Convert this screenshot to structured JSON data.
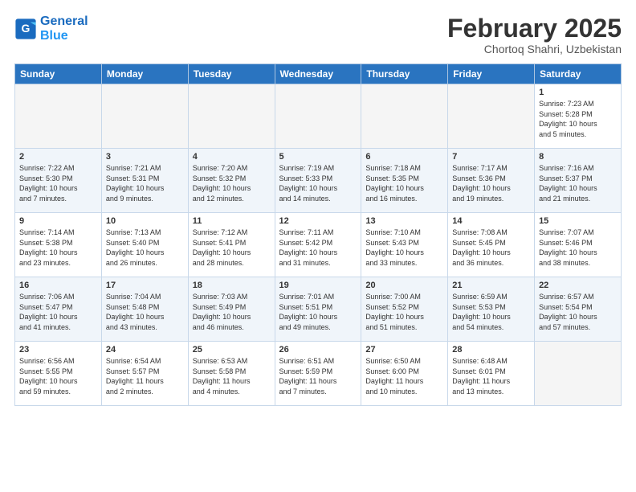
{
  "header": {
    "logo_line1": "General",
    "logo_line2": "Blue",
    "month": "February 2025",
    "location": "Chortoq Shahri, Uzbekistan"
  },
  "days_of_week": [
    "Sunday",
    "Monday",
    "Tuesday",
    "Wednesday",
    "Thursday",
    "Friday",
    "Saturday"
  ],
  "weeks": [
    [
      {
        "num": "",
        "info": ""
      },
      {
        "num": "",
        "info": ""
      },
      {
        "num": "",
        "info": ""
      },
      {
        "num": "",
        "info": ""
      },
      {
        "num": "",
        "info": ""
      },
      {
        "num": "",
        "info": ""
      },
      {
        "num": "1",
        "info": "Sunrise: 7:23 AM\nSunset: 5:28 PM\nDaylight: 10 hours\nand 5 minutes."
      }
    ],
    [
      {
        "num": "2",
        "info": "Sunrise: 7:22 AM\nSunset: 5:30 PM\nDaylight: 10 hours\nand 7 minutes."
      },
      {
        "num": "3",
        "info": "Sunrise: 7:21 AM\nSunset: 5:31 PM\nDaylight: 10 hours\nand 9 minutes."
      },
      {
        "num": "4",
        "info": "Sunrise: 7:20 AM\nSunset: 5:32 PM\nDaylight: 10 hours\nand 12 minutes."
      },
      {
        "num": "5",
        "info": "Sunrise: 7:19 AM\nSunset: 5:33 PM\nDaylight: 10 hours\nand 14 minutes."
      },
      {
        "num": "6",
        "info": "Sunrise: 7:18 AM\nSunset: 5:35 PM\nDaylight: 10 hours\nand 16 minutes."
      },
      {
        "num": "7",
        "info": "Sunrise: 7:17 AM\nSunset: 5:36 PM\nDaylight: 10 hours\nand 19 minutes."
      },
      {
        "num": "8",
        "info": "Sunrise: 7:16 AM\nSunset: 5:37 PM\nDaylight: 10 hours\nand 21 minutes."
      }
    ],
    [
      {
        "num": "9",
        "info": "Sunrise: 7:14 AM\nSunset: 5:38 PM\nDaylight: 10 hours\nand 23 minutes."
      },
      {
        "num": "10",
        "info": "Sunrise: 7:13 AM\nSunset: 5:40 PM\nDaylight: 10 hours\nand 26 minutes."
      },
      {
        "num": "11",
        "info": "Sunrise: 7:12 AM\nSunset: 5:41 PM\nDaylight: 10 hours\nand 28 minutes."
      },
      {
        "num": "12",
        "info": "Sunrise: 7:11 AM\nSunset: 5:42 PM\nDaylight: 10 hours\nand 31 minutes."
      },
      {
        "num": "13",
        "info": "Sunrise: 7:10 AM\nSunset: 5:43 PM\nDaylight: 10 hours\nand 33 minutes."
      },
      {
        "num": "14",
        "info": "Sunrise: 7:08 AM\nSunset: 5:45 PM\nDaylight: 10 hours\nand 36 minutes."
      },
      {
        "num": "15",
        "info": "Sunrise: 7:07 AM\nSunset: 5:46 PM\nDaylight: 10 hours\nand 38 minutes."
      }
    ],
    [
      {
        "num": "16",
        "info": "Sunrise: 7:06 AM\nSunset: 5:47 PM\nDaylight: 10 hours\nand 41 minutes."
      },
      {
        "num": "17",
        "info": "Sunrise: 7:04 AM\nSunset: 5:48 PM\nDaylight: 10 hours\nand 43 minutes."
      },
      {
        "num": "18",
        "info": "Sunrise: 7:03 AM\nSunset: 5:49 PM\nDaylight: 10 hours\nand 46 minutes."
      },
      {
        "num": "19",
        "info": "Sunrise: 7:01 AM\nSunset: 5:51 PM\nDaylight: 10 hours\nand 49 minutes."
      },
      {
        "num": "20",
        "info": "Sunrise: 7:00 AM\nSunset: 5:52 PM\nDaylight: 10 hours\nand 51 minutes."
      },
      {
        "num": "21",
        "info": "Sunrise: 6:59 AM\nSunset: 5:53 PM\nDaylight: 10 hours\nand 54 minutes."
      },
      {
        "num": "22",
        "info": "Sunrise: 6:57 AM\nSunset: 5:54 PM\nDaylight: 10 hours\nand 57 minutes."
      }
    ],
    [
      {
        "num": "23",
        "info": "Sunrise: 6:56 AM\nSunset: 5:55 PM\nDaylight: 10 hours\nand 59 minutes."
      },
      {
        "num": "24",
        "info": "Sunrise: 6:54 AM\nSunset: 5:57 PM\nDaylight: 11 hours\nand 2 minutes."
      },
      {
        "num": "25",
        "info": "Sunrise: 6:53 AM\nSunset: 5:58 PM\nDaylight: 11 hours\nand 4 minutes."
      },
      {
        "num": "26",
        "info": "Sunrise: 6:51 AM\nSunset: 5:59 PM\nDaylight: 11 hours\nand 7 minutes."
      },
      {
        "num": "27",
        "info": "Sunrise: 6:50 AM\nSunset: 6:00 PM\nDaylight: 11 hours\nand 10 minutes."
      },
      {
        "num": "28",
        "info": "Sunrise: 6:48 AM\nSunset: 6:01 PM\nDaylight: 11 hours\nand 13 minutes."
      },
      {
        "num": "",
        "info": ""
      }
    ]
  ]
}
